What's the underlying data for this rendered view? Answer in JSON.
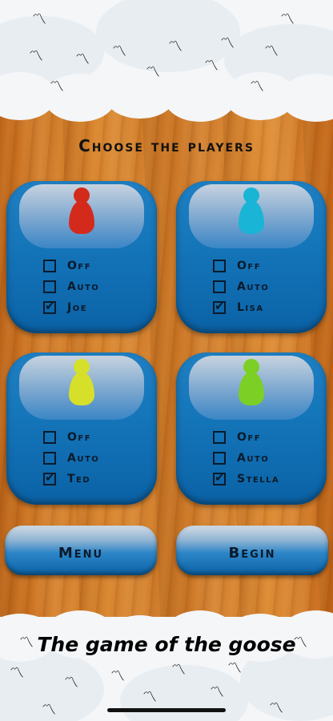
{
  "title": "Choose the players",
  "players": [
    {
      "color": "#d42a1c",
      "options": [
        "Off",
        "Auto",
        "Joe"
      ],
      "selected": 2
    },
    {
      "color": "#19b4d6",
      "options": [
        "Off",
        "Auto",
        "Lisa"
      ],
      "selected": 2
    },
    {
      "color": "#d6e02a",
      "options": [
        "Off",
        "Auto",
        "Ted"
      ],
      "selected": 2
    },
    {
      "color": "#7ccf25",
      "options": [
        "Off",
        "Auto",
        "Stella"
      ],
      "selected": 2
    }
  ],
  "buttons": {
    "menu": "Menu",
    "begin": "Begin"
  },
  "footer_title": "The game of the goose",
  "icons": {
    "bird": "bird-icon",
    "pawn": "pawn-icon",
    "checkbox": "checkbox-icon"
  }
}
